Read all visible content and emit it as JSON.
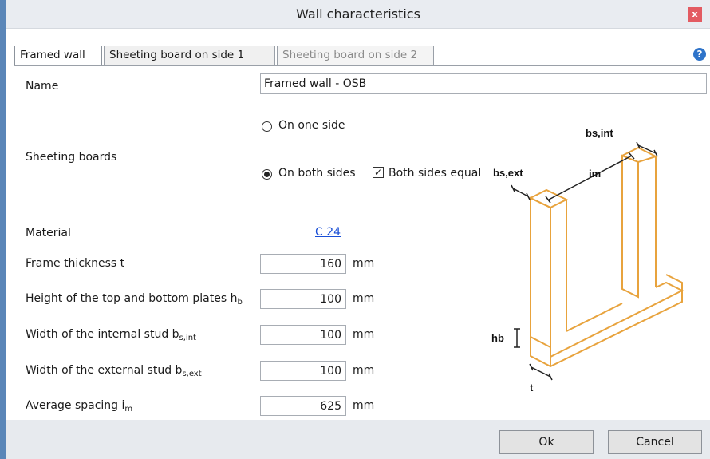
{
  "window": {
    "title": "Wall characteristics",
    "close_glyph": "x"
  },
  "tabs": [
    {
      "label": "Framed wall",
      "state": "active"
    },
    {
      "label": "Sheeting board on side 1",
      "state": "normal"
    },
    {
      "label": "Sheeting board on side 2",
      "state": "disabled"
    }
  ],
  "help_glyph": "?",
  "form": {
    "name": {
      "label": "Name",
      "value": "Framed wall - OSB"
    },
    "sheeting": {
      "label": "Sheeting boards",
      "option_one": "On one side",
      "option_both": "On both sides",
      "selected": "On both sides",
      "equal_label": "Both sides equal",
      "equal_checked": true
    },
    "material": {
      "label": "Material",
      "value": "C 24"
    },
    "frame_thickness": {
      "label": "Frame thickness t",
      "value": "160",
      "unit": "mm"
    },
    "plate_height": {
      "label": "Height of the top and bottom plates h",
      "sub": "b",
      "value": "100",
      "unit": "mm"
    },
    "internal_stud": {
      "label": "Width of the internal stud b",
      "sub": "s,int",
      "value": "100",
      "unit": "mm"
    },
    "external_stud": {
      "label": "Width of the external stud b",
      "sub": "s,ext",
      "value": "100",
      "unit": "mm"
    },
    "spacing": {
      "label": "Average spacing i",
      "sub": "m",
      "value": "625",
      "unit": "mm"
    }
  },
  "diagram": {
    "labels": {
      "bs_int": "bs,int",
      "bs_ext": "bs,ext",
      "im": "im",
      "hb": "hb",
      "t": "t"
    },
    "stroke_color": "#e8a33d"
  },
  "buttons": {
    "ok": "Ok",
    "cancel": "Cancel"
  },
  "colors": {
    "accent": "#5a86b8",
    "close": "#e35b62",
    "link": "#1a4fd6",
    "help": "#2e73c9"
  }
}
